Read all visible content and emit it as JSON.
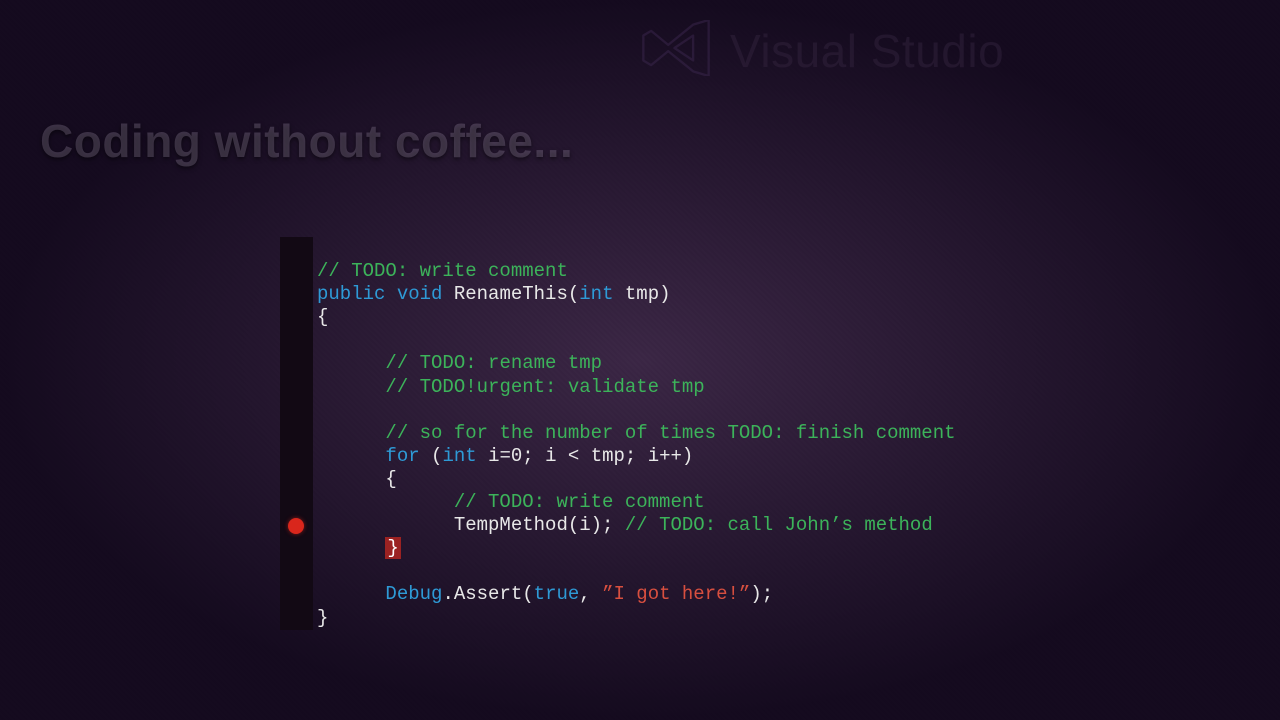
{
  "branding": {
    "product": "Visual Studio"
  },
  "tagline": "Coding without coffee...",
  "breakpoint_line_index": 12,
  "code": {
    "l0": {
      "comment": "// TODO: write comment"
    },
    "l1": {
      "kw_public": "public",
      "kw_void": "void",
      "method": "RenameThis",
      "p_open": "(",
      "kw_int": "int",
      "param": "tmp",
      "p_close": ")"
    },
    "l2": {
      "brace": "{"
    },
    "l3": {
      "blank": ""
    },
    "l4": {
      "comment": "// TODO: rename tmp"
    },
    "l5": {
      "comment": "// TODO!urgent: validate tmp"
    },
    "l6": {
      "blank": ""
    },
    "l7": {
      "comment": "// so for the number of times TODO: finish comment"
    },
    "l8": {
      "kw_for": "for",
      "p_open": "(",
      "kw_int": "int",
      "init": "i=0; i < tmp; i++",
      "p_close": ")"
    },
    "l9": {
      "brace": "{"
    },
    "l10": {
      "comment": "// TODO: write comment"
    },
    "l11": {
      "call": "TempMethod(i);",
      "trail_comment": "// TODO: call John’s method"
    },
    "l12": {
      "brace": "}"
    },
    "l13": {
      "blank": ""
    },
    "l14": {
      "cls": "Debug",
      "dot": ".",
      "method": "Assert",
      "p_open": "(",
      "kw_true": "true",
      "comma": ", ",
      "str": "”I got here!”",
      "p_close": ");"
    },
    "l15": {
      "brace": "}"
    }
  }
}
